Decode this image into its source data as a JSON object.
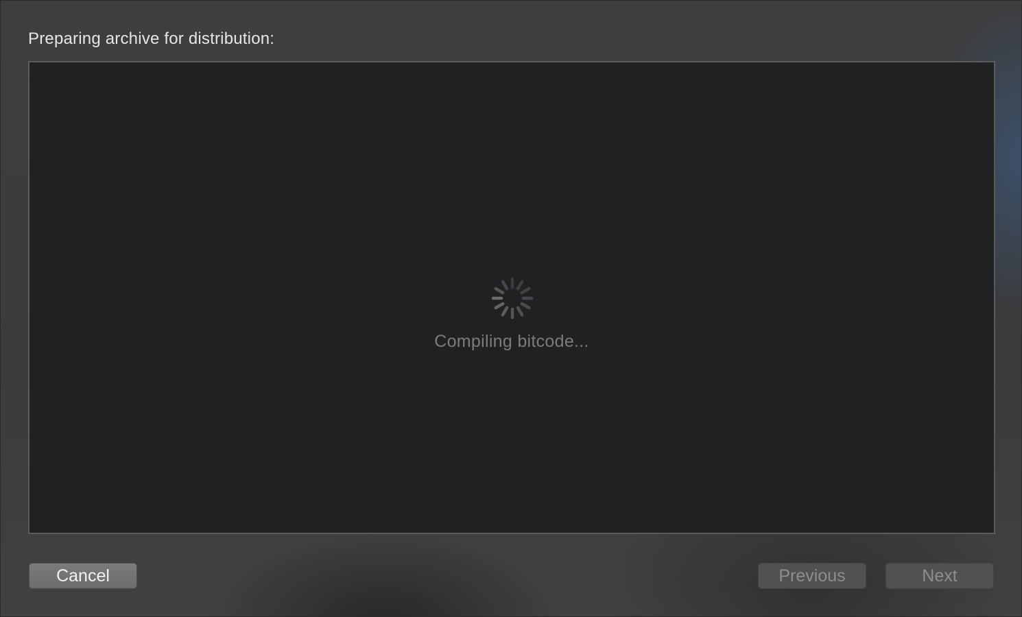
{
  "dialog": {
    "title": "Preparing archive for distribution:",
    "status": "Compiling bitcode...",
    "spinner_icon": "activity-spinner-icon"
  },
  "buttons": {
    "cancel_label": "Cancel",
    "previous_label": "Previous",
    "next_label": "Next"
  },
  "colors": {
    "panel_background": "#202123",
    "sheet_background": "#3b3c3e",
    "status_text": "#7b7c7e"
  }
}
